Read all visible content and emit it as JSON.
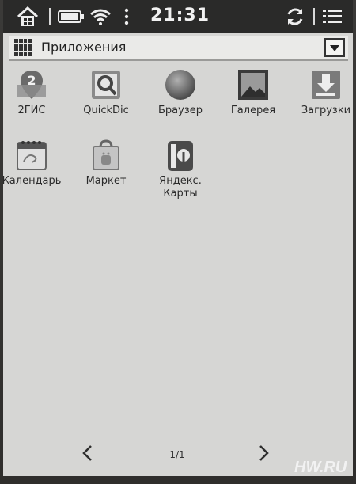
{
  "status_bar": {
    "time": "21:31",
    "icons": [
      "home-icon",
      "battery-icon",
      "wifi-icon",
      "more-vert-icon",
      "sync-icon",
      "menu-icon"
    ]
  },
  "title_bar": {
    "title": "Приложения"
  },
  "apps": [
    {
      "label": "2ГИС",
      "icon": "2gis-icon"
    },
    {
      "label": "QuickDic",
      "icon": "quickdic-icon"
    },
    {
      "label": "Браузер",
      "icon": "browser-globe-icon"
    },
    {
      "label": "Галерея",
      "icon": "gallery-icon"
    },
    {
      "label": "Загрузки",
      "icon": "downloads-icon"
    },
    {
      "label": "Календарь",
      "icon": "calendar-icon"
    },
    {
      "label": "Маркет",
      "icon": "market-bag-icon"
    },
    {
      "label": "Яндекс.\nКарты",
      "icon": "yandex-maps-icon"
    }
  ],
  "pager": {
    "page_label": "1/1"
  },
  "watermark": "HW.RU"
}
